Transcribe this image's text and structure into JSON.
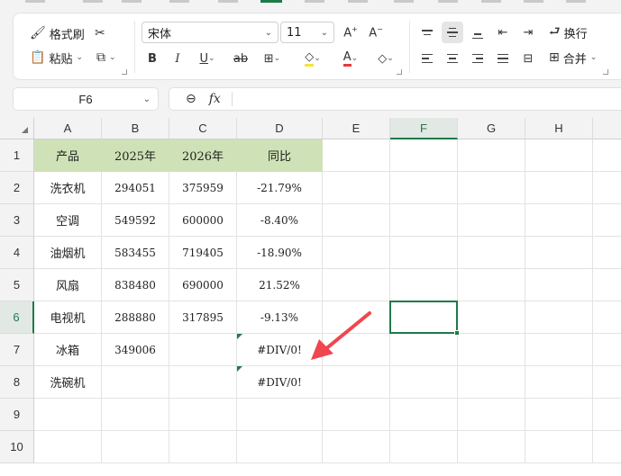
{
  "ribbon": {
    "format_painter_label": "格式刷",
    "paste_label": "粘贴",
    "font_name": "宋体",
    "font_size": "11",
    "wrap_label": "换行",
    "merge_label": "合并"
  },
  "formula_bar": {
    "name_box": "F6",
    "fx_label": "fx",
    "formula": ""
  },
  "columns": [
    "A",
    "B",
    "C",
    "D",
    "E",
    "F",
    "G",
    "H"
  ],
  "active_column": "F",
  "rows": [
    "1",
    "2",
    "3",
    "4",
    "5",
    "6",
    "7",
    "8",
    "9",
    "10"
  ],
  "active_row": "6",
  "table": {
    "header": [
      "产品",
      "2025年",
      "2026年",
      "同比"
    ],
    "rows": [
      [
        "洗衣机",
        "294051",
        "375959",
        "-21.79%"
      ],
      [
        "空调",
        "549592",
        "600000",
        "-8.40%"
      ],
      [
        "油烟机",
        "583455",
        "719405",
        "-18.90%"
      ],
      [
        "风扇",
        "838480",
        "690000",
        "21.52%"
      ],
      [
        "电视机",
        "288880",
        "317895",
        "-9.13%"
      ],
      [
        "冰箱",
        "349006",
        "",
        "#DIV/0!"
      ],
      [
        "洗碗机",
        "",
        "",
        "#DIV/0!"
      ]
    ]
  },
  "colors": {
    "header_fill": "#cfe2b7",
    "accent": "#1f7a4a",
    "arrow": "#f0464f"
  }
}
